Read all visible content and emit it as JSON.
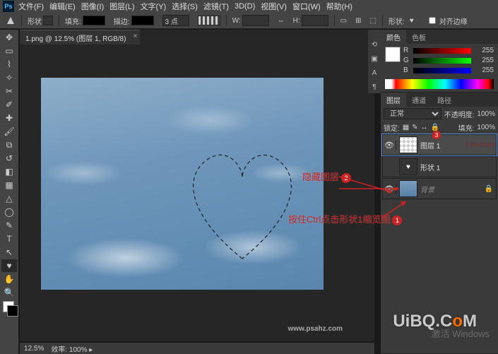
{
  "menu": {
    "file": "文件(F)",
    "edit": "编辑(E)",
    "image": "图像(I)",
    "layer": "图层(L)",
    "type": "文字(Y)",
    "select": "选择(S)",
    "filter": "滤镜(T)",
    "three_d": "3D(D)",
    "view": "视图(V)",
    "window": "窗口(W)",
    "help": "帮助(H)"
  },
  "options": {
    "shape_label": "形状",
    "fill_label": "填充:",
    "stroke_label": "描边:",
    "stroke_width": "3 点",
    "w_label": "W:",
    "h_label": "H:",
    "align_edges": "对齐边缘",
    "shape_type": "形状:"
  },
  "doc": {
    "tab_title": "1.png @ 12.5% (图层 1, RGB/8)",
    "zoom": "12.5%",
    "efficiency_label": "效率:",
    "efficiency_value": "100%"
  },
  "panels": {
    "color_tab": "颜色",
    "swatches_tab": "色板",
    "layers_tab": "图层",
    "channels_tab": "通道",
    "paths_tab": "路径"
  },
  "color": {
    "r_label": "R",
    "g_label": "G",
    "b_label": "B",
    "r": "255",
    "g": "255",
    "b": "255"
  },
  "layers": {
    "blend_mode": "正常",
    "opacity_label": "不透明度:",
    "opacity": "100%",
    "lock_label": "锁定:",
    "fill_label": "填充:",
    "fill": "100%",
    "layer1": "图层 1",
    "layer1_note": "Ctrl+Shift+",
    "shape1": "形状 1",
    "background": "背景"
  },
  "annotations": {
    "hide_layer": "隐藏图层",
    "ctrl_click": "按住Ctrl点击形状1缩览图",
    "num1": "1",
    "num2": "2",
    "num3": "3"
  },
  "watermarks": {
    "psahz": "www.psahz.com",
    "uibq1": "UiBQ.C",
    "uibq2": "M"
  },
  "activate": "激活 Windows",
  "tools": {
    "move": "move",
    "marquee": "marquee",
    "lasso": "lasso",
    "wand": "wand",
    "crop": "crop",
    "eyedropper": "eyedropper",
    "heal": "heal",
    "brush": "brush",
    "stamp": "stamp",
    "history": "history",
    "eraser": "eraser",
    "gradient": "gradient",
    "blur": "blur",
    "dodge": "dodge",
    "pen": "pen",
    "type": "type",
    "path": "path",
    "shape": "shape",
    "hand": "hand",
    "zoom": "zoom"
  }
}
